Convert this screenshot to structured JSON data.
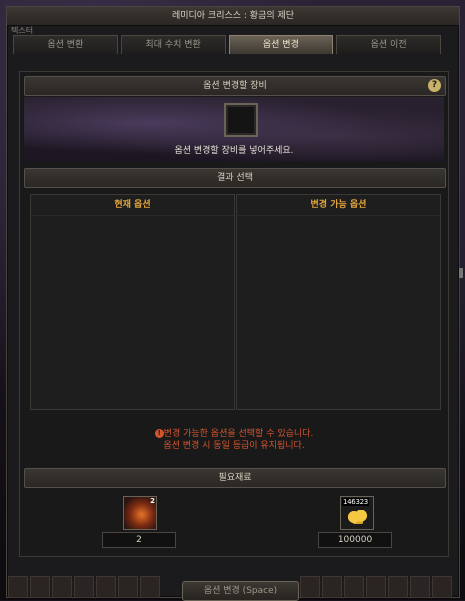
{
  "window": {
    "title": "레미디아 크리스스 : 황금의 제단",
    "corner_label": "텍스터"
  },
  "tabs": [
    {
      "label": "옵션 변환"
    },
    {
      "label": "최대 수치 변환"
    },
    {
      "label": "옵션 변경",
      "active": true
    },
    {
      "label": "옵션 이전"
    }
  ],
  "equip_section": {
    "header": "옵션 변경할 장비",
    "help_icon": "?",
    "message": "옵션 변경할 장비를 넣어주세요."
  },
  "result_section": {
    "header": "결과 선택",
    "current_options_header": "현재 옵션",
    "changeable_options_header": "변경 가능 옵션"
  },
  "notice": {
    "line1": "변경 가능한 옵션을 선택할 수 있습니다.",
    "line2": "옵션 변경 시 동일 등급이 유지됩니다."
  },
  "materials": {
    "header": "필요재료",
    "items": [
      {
        "icon": "rune-stone-icon",
        "count_badge": "2",
        "quantity": "2"
      },
      {
        "icon": "gold-coins-icon",
        "amount_badge": "146323",
        "quantity": "100000"
      }
    ]
  },
  "action_button": {
    "label": "옵션 변경 (Space)"
  },
  "colors": {
    "accent_orange": "#e4a63c",
    "notice_red": "#d3552e",
    "active_tab": "#6a6255"
  }
}
